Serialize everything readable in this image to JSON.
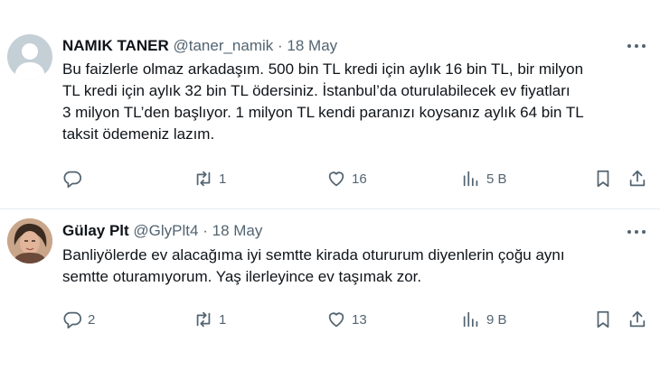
{
  "tweets": [
    {
      "name": "NAMIK TANER",
      "handle": "@taner_namik",
      "separator": "·",
      "date": "18 May",
      "lines": [
        "Bu faizlerle olmaz arkadaşım. 500 bin TL kredi için aylık 16 bin TL, bir milyon",
        "TL kredi için aylık 32 bin TL ödersiniz. İstanbul’da oturulabilecek ev fiyatları",
        "3 milyon TL’den başlıyor. 1 milyon TL kendi paranızı koysanız aylık 64 bin TL",
        "taksit ödemeniz lazım."
      ],
      "replies": "",
      "retweets": "1",
      "likes": "16",
      "views": "5 B",
      "avatar_icon": "default-avatar-icon"
    },
    {
      "name": "Gülay Plt",
      "handle": "@GlyPlt4",
      "separator": "·",
      "date": "18 May",
      "lines": [
        "Banliyölerde ev alacağıma iyi semtte kirada otururum diyenlerin çoğu aynı",
        "semtte oturamıyorum. Yaş ilerleyince ev taşımak zor."
      ],
      "replies": "2",
      "retweets": "1",
      "likes": "13",
      "views": "9 B",
      "avatar_icon": "user-photo"
    }
  ],
  "colors": {
    "text": "#0f1419",
    "secondary": "#536471",
    "divider": "#e6ecf0"
  },
  "icons": [
    "reply-icon",
    "retweet-icon",
    "like-icon",
    "views-icon",
    "bookmark-icon",
    "share-icon",
    "more-icon"
  ]
}
